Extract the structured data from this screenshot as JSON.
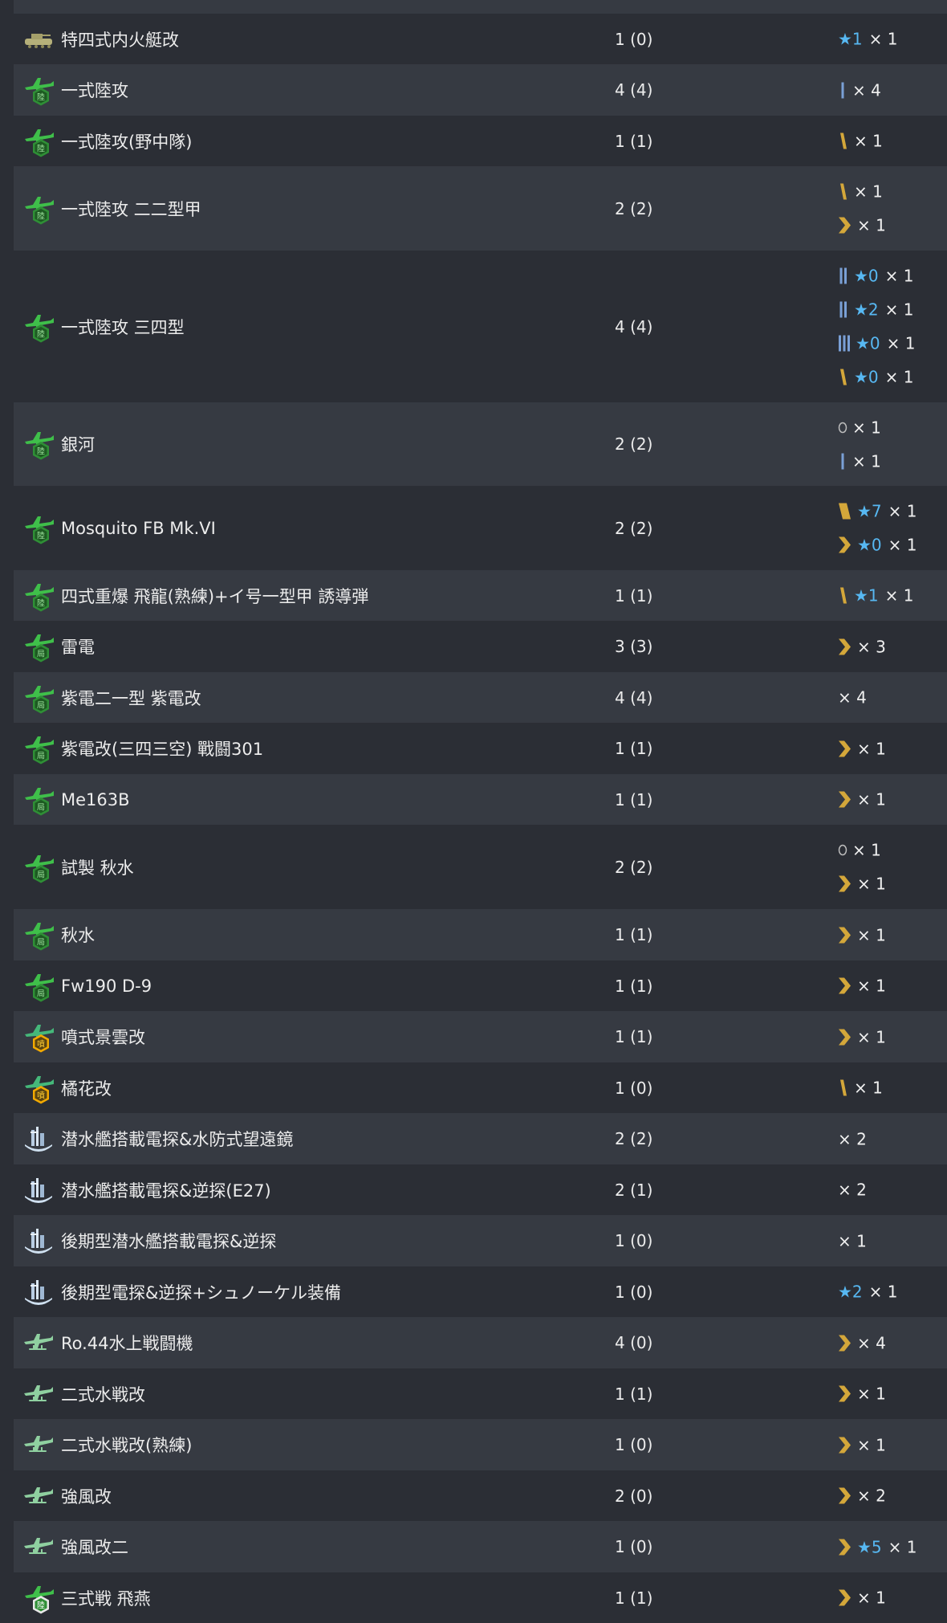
{
  "colors": {
    "row_alt": "#363a42",
    "row_base": "#2b2e35",
    "text": "#ececec",
    "star": "#57b8f2",
    "proficiency_gold": "#d4a73a",
    "proficiency_blue": "#7aa0d6",
    "land_base_badge": "#2e9d3a",
    "jet_badge": "#f2a900"
  },
  "rows": [
    {
      "name": "特四式内火艇改",
      "icon": "amphibious-tank-icon",
      "count": "1 (0)",
      "h": 63,
      "alt": false,
      "profs": [
        {
          "badge": "",
          "star": "★1",
          "mult": "× 1"
        }
      ]
    },
    {
      "name": "一式陸攻",
      "icon": "land-attacker-icon",
      "count": "4 (4)",
      "h": 64,
      "alt": true,
      "profs": [
        {
          "badge": "prof-1",
          "star": "",
          "mult": "× 4"
        }
      ]
    },
    {
      "name": "一式陸攻(野中隊)",
      "icon": "land-attacker-icon",
      "count": "1 (1)",
      "h": 63,
      "alt": false,
      "profs": [
        {
          "badge": "prof-4",
          "star": "",
          "mult": "× 1"
        }
      ]
    },
    {
      "name": "一式陸攻 二二型甲",
      "icon": "land-attacker-icon",
      "count": "2 (2)",
      "h": 105,
      "alt": true,
      "profs": [
        {
          "badge": "prof-4",
          "star": "",
          "mult": "× 1"
        },
        {
          "badge": "prof-7",
          "star": "",
          "mult": "× 1"
        }
      ]
    },
    {
      "name": "一式陸攻 三四型",
      "icon": "land-attacker-icon",
      "count": "4 (4)",
      "h": 189,
      "alt": false,
      "profs": [
        {
          "badge": "prof-2",
          "star": "★0",
          "mult": "× 1"
        },
        {
          "badge": "prof-2",
          "star": "★2",
          "mult": "× 1"
        },
        {
          "badge": "prof-3",
          "star": "★0",
          "mult": "× 1"
        },
        {
          "badge": "prof-4",
          "star": "★0",
          "mult": "× 1"
        }
      ]
    },
    {
      "name": "銀河",
      "icon": "land-attacker-icon",
      "count": "2 (2)",
      "h": 104,
      "alt": true,
      "profs": [
        {
          "badge": "prof-0",
          "star": "",
          "mult": "× 1"
        },
        {
          "badge": "prof-1",
          "star": "",
          "mult": "× 1"
        }
      ]
    },
    {
      "name": "Mosquito FB Mk.VI",
      "icon": "land-attacker-icon",
      "count": "2 (2)",
      "h": 105,
      "alt": false,
      "profs": [
        {
          "badge": "prof-6",
          "star": "★7",
          "mult": "× 1"
        },
        {
          "badge": "prof-7",
          "star": "★0",
          "mult": "× 1"
        }
      ]
    },
    {
      "name": "四式重爆 飛龍(熟練)+イ号一型甲 誘導弾",
      "icon": "land-attacker-icon",
      "count": "1 (1)",
      "h": 63,
      "alt": true,
      "profs": [
        {
          "badge": "prof-4",
          "star": "★1",
          "mult": "× 1"
        }
      ]
    },
    {
      "name": "雷電",
      "icon": "interceptor-icon",
      "count": "3 (3)",
      "h": 64,
      "alt": false,
      "profs": [
        {
          "badge": "prof-7",
          "star": "",
          "mult": "× 3"
        }
      ]
    },
    {
      "name": "紫電二一型 紫電改",
      "icon": "interceptor-icon",
      "count": "4 (4)",
      "h": 63,
      "alt": true,
      "profs": [
        {
          "badge": "",
          "star": "",
          "mult": "× 4"
        }
      ]
    },
    {
      "name": "紫電改(三四三空) 戰闘301",
      "icon": "interceptor-icon",
      "count": "1 (1)",
      "h": 64,
      "alt": false,
      "profs": [
        {
          "badge": "prof-7",
          "star": "",
          "mult": "× 1"
        }
      ]
    },
    {
      "name": "Me163B",
      "icon": "interceptor-icon",
      "count": "1 (1)",
      "h": 63,
      "alt": true,
      "profs": [
        {
          "badge": "prof-7",
          "star": "",
          "mult": "× 1"
        }
      ]
    },
    {
      "name": "試製 秋水",
      "icon": "interceptor-icon",
      "count": "2 (2)",
      "h": 105,
      "alt": false,
      "profs": [
        {
          "badge": "prof-0",
          "star": "",
          "mult": "× 1"
        },
        {
          "badge": "prof-7",
          "star": "",
          "mult": "× 1"
        }
      ]
    },
    {
      "name": "秋水",
      "icon": "interceptor-icon",
      "count": "1 (1)",
      "h": 64,
      "alt": true,
      "profs": [
        {
          "badge": "prof-7",
          "star": "",
          "mult": "× 1"
        }
      ]
    },
    {
      "name": "Fw190 D-9",
      "icon": "interceptor-icon",
      "count": "1 (1)",
      "h": 63,
      "alt": false,
      "profs": [
        {
          "badge": "prof-7",
          "star": "",
          "mult": "× 1"
        }
      ]
    },
    {
      "name": "噴式景雲改",
      "icon": "jet-bomber-icon",
      "count": "1 (1)",
      "h": 64,
      "alt": true,
      "profs": [
        {
          "badge": "prof-7",
          "star": "",
          "mult": "× 1"
        }
      ]
    },
    {
      "name": "橘花改",
      "icon": "jet-bomber-icon",
      "count": "1 (0)",
      "h": 63,
      "alt": false,
      "profs": [
        {
          "badge": "prof-4",
          "star": "",
          "mult": "× 1"
        }
      ]
    },
    {
      "name": "潜水艦搭載電探&水防式望遠鏡",
      "icon": "submarine-radar-icon",
      "count": "2 (2)",
      "h": 64,
      "alt": true,
      "profs": [
        {
          "badge": "",
          "star": "",
          "mult": "× 2"
        }
      ]
    },
    {
      "name": "潜水艦搭載電探&逆探(E27)",
      "icon": "submarine-radar-icon",
      "count": "2 (1)",
      "h": 63,
      "alt": false,
      "profs": [
        {
          "badge": "",
          "star": "",
          "mult": "× 2"
        }
      ]
    },
    {
      "name": "後期型潜水艦搭載電探&逆探",
      "icon": "submarine-radar-icon",
      "count": "1 (0)",
      "h": 64,
      "alt": true,
      "profs": [
        {
          "badge": "",
          "star": "",
          "mult": "× 1"
        }
      ]
    },
    {
      "name": "後期型電探&逆探+シュノーケル装備",
      "icon": "submarine-radar-icon",
      "count": "1 (0)",
      "h": 63,
      "alt": false,
      "profs": [
        {
          "badge": "",
          "star": "★2",
          "mult": "× 1"
        }
      ]
    },
    {
      "name": "Ro.44水上戦闘機",
      "icon": "seaplane-fighter-icon",
      "count": "4 (0)",
      "h": 64,
      "alt": true,
      "profs": [
        {
          "badge": "prof-7",
          "star": "",
          "mult": "× 4"
        }
      ]
    },
    {
      "name": "二式水戦改",
      "icon": "seaplane-fighter-icon",
      "count": "1 (1)",
      "h": 63,
      "alt": false,
      "profs": [
        {
          "badge": "prof-7",
          "star": "",
          "mult": "× 1"
        }
      ]
    },
    {
      "name": "二式水戦改(熟練)",
      "icon": "seaplane-fighter-icon",
      "count": "1 (0)",
      "h": 64,
      "alt": true,
      "profs": [
        {
          "badge": "prof-7",
          "star": "",
          "mult": "× 1"
        }
      ]
    },
    {
      "name": "強風改",
      "icon": "seaplane-fighter-icon",
      "count": "2 (0)",
      "h": 63,
      "alt": false,
      "profs": [
        {
          "badge": "prof-7",
          "star": "",
          "mult": "× 2"
        }
      ]
    },
    {
      "name": "強風改二",
      "icon": "seaplane-fighter-icon",
      "count": "1 (0)",
      "h": 64,
      "alt": true,
      "profs": [
        {
          "badge": "prof-7",
          "star": "★5",
          "mult": "× 1"
        }
      ]
    },
    {
      "name": "三式戦 飛燕",
      "icon": "land-fighter-icon",
      "count": "1 (1)",
      "h": 63,
      "alt": false,
      "profs": [
        {
          "badge": "prof-7",
          "star": "",
          "mult": "× 1"
        }
      ]
    }
  ]
}
